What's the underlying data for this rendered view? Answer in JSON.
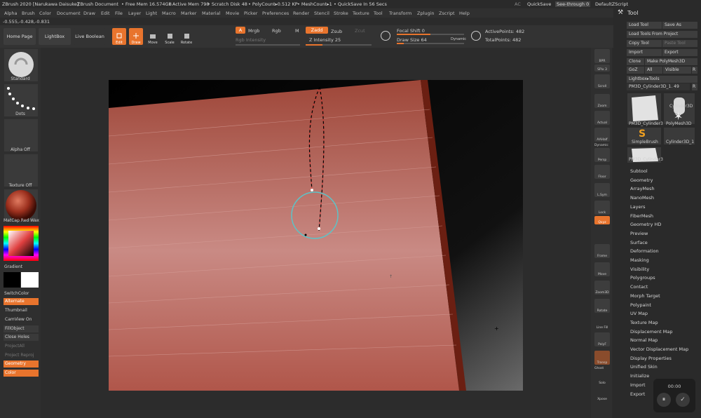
{
  "titlebar": {
    "app": "ZBrush 2020 [Narukawa Daisuke]",
    "doc": "ZBrush Document",
    "free_mem": "• Free Mem 16.574GB",
    "active_mem": "• Active Mem 798",
    "scratch": "• Scratch Disk 48",
    "polycount": "• PolyCount▸0.512 KP",
    "meshcount": "• MeshCount▸1",
    "quicksave": "• QuickSave In 56 Secs",
    "ac": "AC",
    "quicksave_btn": "QuickSave",
    "seethrough": "See-through  0",
    "zscript": "DefaultZScript"
  },
  "menu": [
    "Alpha",
    "Brush",
    "Color",
    "Document",
    "Draw",
    "Edit",
    "File",
    "Layer",
    "Light",
    "Macro",
    "Marker",
    "Material",
    "Movie",
    "Picker",
    "Preferences",
    "Render",
    "Stencil",
    "Stroke",
    "Texture",
    "Tool",
    "Transform",
    "Zplugin",
    "Zscript",
    "Help"
  ],
  "coords": "-0.555,-0.428,-0.831",
  "shelf": {
    "home": "Home Page",
    "lightbox": "LightBox",
    "live_boolean": "Live Boolean",
    "edit": "Edit",
    "draw": "Draw",
    "move": "Move",
    "scale": "Scale",
    "rotate": "Rotate",
    "a": "A",
    "mrgb": "Mrgb",
    "rgb": "Rgb",
    "m": "M",
    "zadd": "Zadd",
    "zsub": "Zsub",
    "zcut": "Zcut",
    "rgb_intensity": "Rgb Intensity",
    "z_intensity": "Z Intensity 25",
    "focal_shift": "Focal Shift 0",
    "draw_size": "Draw Size 64",
    "dynamic": "Dynamic",
    "active_points": "ActivePoints: 482",
    "total_points": "TotalPoints: 482",
    "z_intensity_level": 0.25,
    "draw_size_level": 0.1,
    "focal_shift_level": 0.5
  },
  "left": {
    "standard": "Standard",
    "dots": "Dots",
    "alpha_off": "Alpha Off",
    "texture_off": "Texture Off",
    "matcap": "MatCap Red Wax",
    "gradient": "Gradient",
    "switchcolor": "SwitchColor",
    "alternate": "Alternate",
    "thumbnail": "Thumbnail",
    "camview": "CamView On",
    "fillobject": "FillObject",
    "closeholes": "Close Holes",
    "projectall": "ProjectAll",
    "projectreproj": "Project Reproj",
    "geometry": "Geometry",
    "color": "Color"
  },
  "right": {
    "bpr": "BPR",
    "spix": "SPix 3",
    "scroll": "Scroll",
    "zoom": "Zoom",
    "actual": "Actual",
    "aahalf": "AAHalf",
    "dynamic": "Dynamic",
    "persp": "Persp",
    "floor": "Floor",
    "local": "L.Sym",
    "lock": "Lock",
    "qxyz": "Qxyz",
    "frame": "Frame",
    "move": "Move",
    "zoom3d": "Zoom3D",
    "rotate": "Rotate",
    "linefill": "Line Fill",
    "polyf": "PolyF",
    "transp": "Transp",
    "ghost": "Ghost",
    "solo": "Solo",
    "xpose": "Xpose"
  },
  "tool": {
    "title": "Tool",
    "load": "Load Tool",
    "save": "Save As",
    "load_project": "Load Tools From Project",
    "copy": "Copy Tool",
    "paste": "Paste Tool",
    "import": "Import",
    "export": "Export",
    "clone": "Clone",
    "make_polymesh": "Make PolyMesh3D",
    "goz": "GoZ",
    "all": "All",
    "visible": "Visible",
    "r": "R",
    "lightbox_tools": "Lightbox▸Tools",
    "current": "PM3D_Cylinder3D_1. 49",
    "r2": "R",
    "thumbs": [
      "PM3D_Cylinder3",
      "Cylinder3D",
      "PolyMesh3D",
      "SimpleBrush",
      "Cylinder3D_1",
      "PM3D_Cylinder3"
    ],
    "items": [
      "Subtool",
      "Geometry",
      "ArrayMesh",
      "NanoMesh",
      "Layers",
      "FiberMesh",
      "Geometry HD",
      "Preview",
      "Surface",
      "Deformation",
      "Masking",
      "Visibility",
      "Polygroups",
      "Contact",
      "Morph Target",
      "Polypaint",
      "UV Map",
      "Texture Map",
      "Displacement Map",
      "Normal Map",
      "Vector Displacement Map",
      "Display Properties",
      "Unified Skin",
      "Initialize",
      "Import",
      "Export"
    ]
  },
  "overlay": {
    "time": "00:00",
    "pause": "⏸",
    "ok": "✓"
  }
}
